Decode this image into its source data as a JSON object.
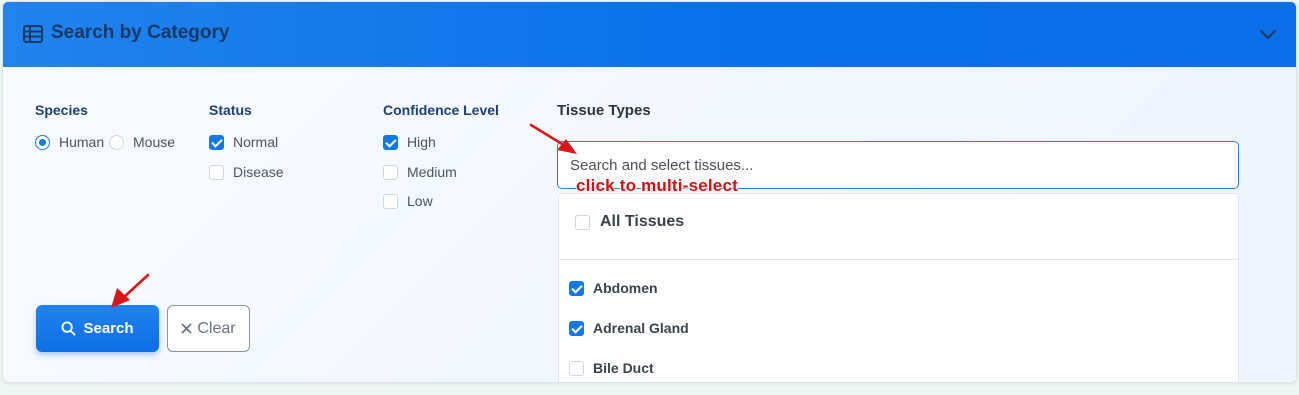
{
  "header": {
    "title": "Search by Category",
    "icon": "table-list-icon",
    "toggle_icon": "chevron-down-icon"
  },
  "species": {
    "title": "Species",
    "options": [
      {
        "label": "Human",
        "selected": true
      },
      {
        "label": "Mouse",
        "selected": false
      }
    ]
  },
  "status": {
    "title": "Status",
    "options": [
      {
        "label": "Normal",
        "checked": true
      },
      {
        "label": "Disease",
        "checked": false
      }
    ]
  },
  "confidence": {
    "title": "Confidence Level",
    "options": [
      {
        "label": "High",
        "checked": true
      },
      {
        "label": "Medium",
        "checked": false
      },
      {
        "label": "Low",
        "checked": false
      }
    ]
  },
  "tissues": {
    "title": "Tissue Types",
    "placeholder": "Search and select tissues...",
    "annotation": "click to multi-select",
    "all_label": "All Tissues",
    "items": [
      {
        "label": "Abdomen",
        "checked": true
      },
      {
        "label": "Adrenal Gland",
        "checked": true
      },
      {
        "label": "Bile Duct",
        "checked": false
      }
    ]
  },
  "actions": {
    "search_label": "Search",
    "clear_label": "Clear"
  },
  "colors": {
    "accent": "#0c6fe6",
    "annotation": "#d20f0f"
  }
}
